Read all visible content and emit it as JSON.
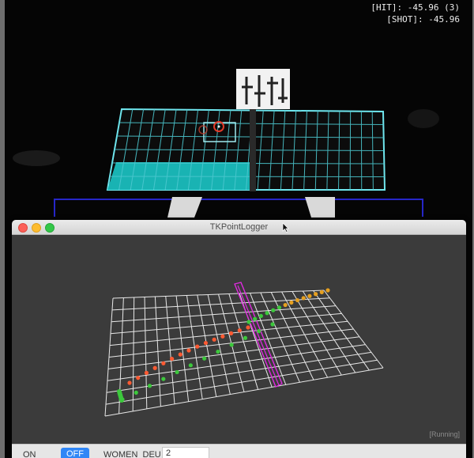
{
  "hud": {
    "hit_line": "[HIT]: -45.96 (3)",
    "shot_line": "[SHOT]: -45.96"
  },
  "colors": {
    "table_grid": "#6fe6ee",
    "table_fill": "#19b3b3",
    "hit_marker": "#e03a2a",
    "plot_grid": "#e8e8e8",
    "ball_trajectory_red": "#ff5a32",
    "ball_trajectory_green": "#3cc83c",
    "ball_trajectory_orange": "#e6a020",
    "net_magenta": "#e02ae0",
    "off_button": "#2f86f6"
  },
  "logger": {
    "window_title": "TKPointLogger",
    "status": "[Running]",
    "on_label": "ON",
    "off_label": "OFF",
    "session_name": "WOMEN_DEU_",
    "trial_value": "2"
  }
}
